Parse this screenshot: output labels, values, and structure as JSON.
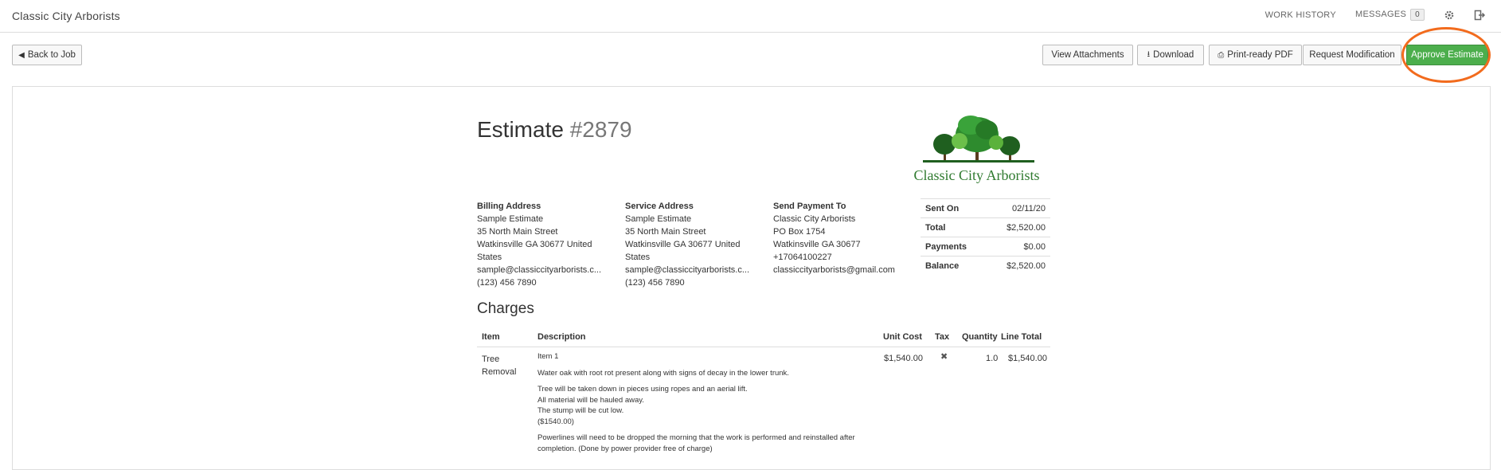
{
  "topbar": {
    "brand": "Classic City Arborists",
    "work_history": "WORK HISTORY",
    "messages": "MESSAGES",
    "messages_count": "0"
  },
  "toolbar": {
    "back": "Back to Job",
    "view_attachments": "View Attachments",
    "download": "Download",
    "print_pdf": "Print-ready PDF",
    "request_mod": "Request Modification",
    "approve": "Approve Estimate"
  },
  "estimate": {
    "label": "Estimate",
    "number": "#2879",
    "logo_text": "Classic City Arborists",
    "billing": {
      "heading": "Billing Address",
      "name": "Sample Estimate",
      "street": "35 North Main Street",
      "city": "Watkinsville GA 30677 United",
      "country": "States",
      "email": "sample@classiccityarborists.c...",
      "phone": "(123) 456 7890"
    },
    "service": {
      "heading": "Service Address",
      "name": "Sample Estimate",
      "street": "35 North Main Street",
      "city": "Watkinsville GA 30677 United",
      "country": "States",
      "email": "sample@classiccityarborists.c...",
      "phone": "(123) 456 7890"
    },
    "payment": {
      "heading": "Send Payment To",
      "name": "Classic City Arborists",
      "box": "PO Box 1754",
      "city": "Watkinsville GA 30677",
      "phone": "+17064100227",
      "email": "classiccityarborists@gmail.com"
    },
    "summary": [
      {
        "label": "Sent On",
        "value": "02/11/20"
      },
      {
        "label": "Total",
        "value": "$2,520.00"
      },
      {
        "label": "Payments",
        "value": "$0.00"
      },
      {
        "label": "Balance",
        "value": "$2,520.00"
      }
    ]
  },
  "charges": {
    "heading": "Charges",
    "columns": {
      "item": "Item",
      "description": "Description",
      "unit_cost": "Unit Cost",
      "tax": "Tax",
      "quantity": "Quantity",
      "line_total": "Line Total"
    },
    "rows": [
      {
        "item": "Tree",
        "item2": "Removal",
        "title": "Item 1",
        "line1": "Water oak with root rot present along with signs of decay in the lower trunk.",
        "line2": "Tree will be taken down in pieces using ropes and an aerial lift.",
        "line3": "All material will be hauled away.",
        "line4": "The stump will be cut low.",
        "line5": "($1540.00)",
        "line6": "Powerlines will need to be dropped the morning that the work is performed and reinstalled after",
        "line7": "completion. (Done by power provider free of charge)",
        "unit_cost": "$1,540.00",
        "tax": "✖",
        "quantity": "1.0",
        "line_total": "$1,540.00"
      }
    ]
  },
  "colors": {
    "approve": "#4cae4c",
    "highlight": "#f26b1d",
    "logo_green": "#2f7a2f"
  }
}
